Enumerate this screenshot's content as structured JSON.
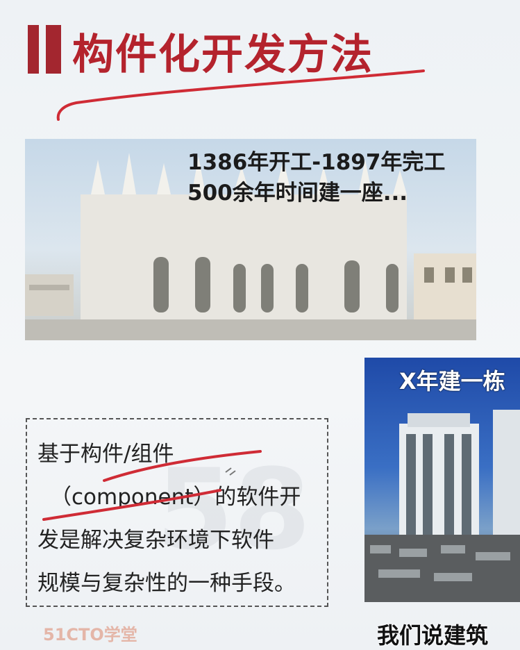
{
  "slide": {
    "title": "构件化开发方法",
    "accent_color": "#b4232d"
  },
  "photo_cathedral": {
    "caption_line1": "1386年开工-1897年完工",
    "caption_line2": "500余年时间建一座..."
  },
  "photo_building": {
    "caption": "X年建一栋"
  },
  "definition_box": {
    "line1": "基于构件/组件",
    "line2": "（component）的软件开",
    "line3": "发是解决复杂环境下软件",
    "line4": "规模与复杂性的一种手段。"
  },
  "branding": {
    "logo": "51CTO学堂",
    "watermark": "58"
  },
  "subtitle": {
    "text": "我们说建筑"
  }
}
